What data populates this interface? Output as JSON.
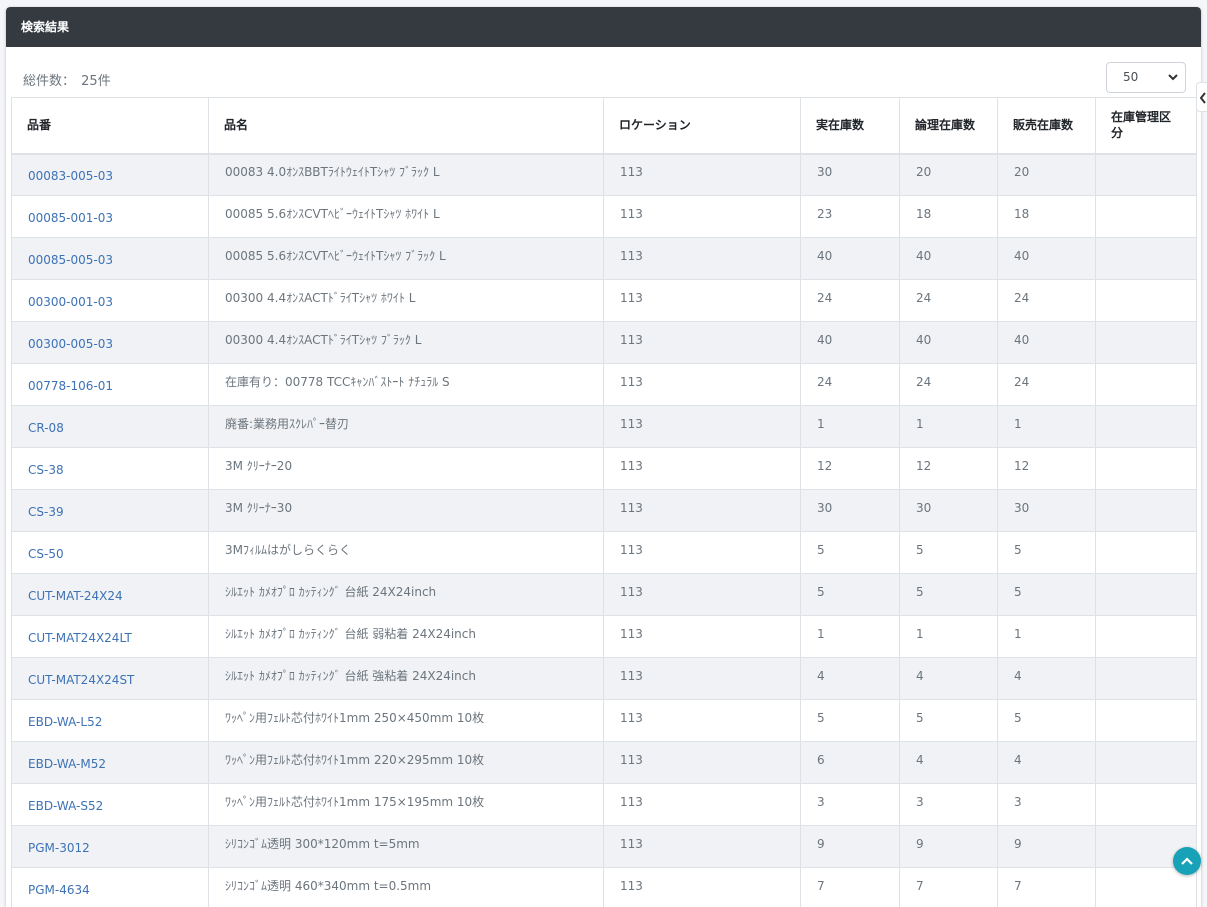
{
  "header": {
    "title": "検索結果"
  },
  "summary": {
    "label": "総件数：",
    "count": "25件"
  },
  "page_size": {
    "selected": "50"
  },
  "columns": [
    "品番",
    "品名",
    "ロケーション",
    "実在庫数",
    "論理在庫数",
    "販売在庫数",
    "在庫管理区分"
  ],
  "rows": [
    {
      "code": "00083-005-03",
      "name": "00083 4.0ｵﾝｽBBTﾗｲﾄｳｪｲﾄTｼｬﾂ ﾌﾞﾗｯｸ L",
      "location": "113",
      "actual": "30",
      "logical": "20",
      "sales": "20",
      "mgmt": ""
    },
    {
      "code": "00085-001-03",
      "name": "00085 5.6ｵﾝｽCVTﾍﾋﾞｰｳｪｲﾄTｼｬﾂ ﾎﾜｲﾄ L",
      "location": "113",
      "actual": "23",
      "logical": "18",
      "sales": "18",
      "mgmt": ""
    },
    {
      "code": "00085-005-03",
      "name": "00085 5.6ｵﾝｽCVTﾍﾋﾞｰｳｪｲﾄTｼｬﾂ ﾌﾞﾗｯｸ L",
      "location": "113",
      "actual": "40",
      "logical": "40",
      "sales": "40",
      "mgmt": ""
    },
    {
      "code": "00300-001-03",
      "name": "00300 4.4ｵﾝｽACTﾄﾞﾗｲTｼｬﾂ ﾎﾜｲﾄ L",
      "location": "113",
      "actual": "24",
      "logical": "24",
      "sales": "24",
      "mgmt": ""
    },
    {
      "code": "00300-005-03",
      "name": "00300 4.4ｵﾝｽACTﾄﾞﾗｲTｼｬﾂ ﾌﾞﾗｯｸ L",
      "location": "113",
      "actual": "40",
      "logical": "40",
      "sales": "40",
      "mgmt": ""
    },
    {
      "code": "00778-106-01",
      "name": "在庫有り：00778 TCCｷｬﾝﾊﾞｽﾄｰﾄ ﾅﾁｭﾗﾙ S",
      "location": "113",
      "actual": "24",
      "logical": "24",
      "sales": "24",
      "mgmt": ""
    },
    {
      "code": "CR-08",
      "name": "廃番:業務用ｽｸﾚﾊﾟｰ替刃",
      "location": "113",
      "actual": "1",
      "logical": "1",
      "sales": "1",
      "mgmt": ""
    },
    {
      "code": "CS-38",
      "name": "3M ｸﾘｰﾅｰ20",
      "location": "113",
      "actual": "12",
      "logical": "12",
      "sales": "12",
      "mgmt": ""
    },
    {
      "code": "CS-39",
      "name": "3M ｸﾘｰﾅｰ30",
      "location": "113",
      "actual": "30",
      "logical": "30",
      "sales": "30",
      "mgmt": ""
    },
    {
      "code": "CS-50",
      "name": "3Mﾌｨﾙﾑはがしらくらく",
      "location": "113",
      "actual": "5",
      "logical": "5",
      "sales": "5",
      "mgmt": ""
    },
    {
      "code": "CUT-MAT-24X24",
      "name": "ｼﾙｴｯﾄ ｶﾒｵﾌﾟﾛ ｶｯﾃｨﾝｸﾞ 台紙 24X24inch",
      "location": "113",
      "actual": "5",
      "logical": "5",
      "sales": "5",
      "mgmt": ""
    },
    {
      "code": "CUT-MAT24X24LT",
      "name": "ｼﾙｴｯﾄ ｶﾒｵﾌﾟﾛ ｶｯﾃｨﾝｸﾞ 台紙 弱粘着 24X24inch",
      "location": "113",
      "actual": "1",
      "logical": "1",
      "sales": "1",
      "mgmt": ""
    },
    {
      "code": "CUT-MAT24X24ST",
      "name": "ｼﾙｴｯﾄ ｶﾒｵﾌﾟﾛ ｶｯﾃｨﾝｸﾞ 台紙 強粘着 24X24inch",
      "location": "113",
      "actual": "4",
      "logical": "4",
      "sales": "4",
      "mgmt": ""
    },
    {
      "code": "EBD-WA-L52",
      "name": "ﾜｯﾍﾟﾝ用ﾌｪﾙﾄ芯付ﾎﾜｲﾄ1mm 250×450mm 10枚",
      "location": "113",
      "actual": "5",
      "logical": "5",
      "sales": "5",
      "mgmt": ""
    },
    {
      "code": "EBD-WA-M52",
      "name": "ﾜｯﾍﾟﾝ用ﾌｪﾙﾄ芯付ﾎﾜｲﾄ1mm 220×295mm 10枚",
      "location": "113",
      "actual": "6",
      "logical": "4",
      "sales": "4",
      "mgmt": ""
    },
    {
      "code": "EBD-WA-S52",
      "name": "ﾜｯﾍﾟﾝ用ﾌｪﾙﾄ芯付ﾎﾜｲﾄ1mm 175×195mm 10枚",
      "location": "113",
      "actual": "3",
      "logical": "3",
      "sales": "3",
      "mgmt": ""
    },
    {
      "code": "PGM-3012",
      "name": "ｼﾘｺﾝｺﾞﾑ透明 300*120mm t=5mm",
      "location": "113",
      "actual": "9",
      "logical": "9",
      "sales": "9",
      "mgmt": ""
    },
    {
      "code": "PGM-4634",
      "name": "ｼﾘｺﾝｺﾞﾑ透明 460*340mm t=0.5mm",
      "location": "113",
      "actual": "7",
      "logical": "7",
      "sales": "7",
      "mgmt": ""
    }
  ]
}
